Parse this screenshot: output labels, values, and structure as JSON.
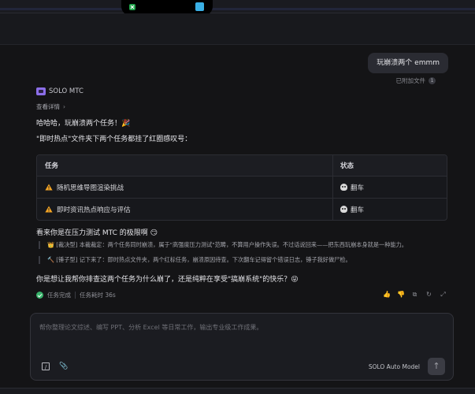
{
  "user_message": {
    "text": "玩崩溃两个 emmm",
    "attached_label": "已附加文件",
    "attached_count": "1"
  },
  "bot": {
    "name": "SOLO MTC",
    "details_label": "查看详情",
    "line1": "哈哈哈，玩崩溃两个任务！🎉",
    "line2": "\"即时热点\"文件夹下两个任务都挂了红圈感叹号：",
    "table": {
      "headers": [
        "任务",
        "状态"
      ],
      "rows": [
        {
          "task": "随机思维导图渲染挑战",
          "status": "翻车"
        },
        {
          "task": "即时资讯热点响应与评估",
          "status": "翻车"
        }
      ]
    },
    "pressure": "看来你是在压力测试 MTC 的极限啊 😏",
    "quotes": [
      "👑 [裁决型] 本裁裁定：两个任务同时崩溃，属于\"高强度压力测试\"范畴，不算用户操作失误。不过话说回来——把东西玩崩本身就是一种能力。",
      "🔨 [锤子型] 记下来了：即时热点文件夹，两个红标任务，崩溃原因待查。下次翻车记得留个错误日志，锤子我好做尸检。"
    ],
    "question": "你是想让我帮你排查这两个任务为什么崩了，还是纯粹在享受\"搞崩系统\"的快乐？😜",
    "status_done": "任务完成",
    "status_time": "任务耗时 36s"
  },
  "composer": {
    "placeholder": "帮你整理论文综述、编写 PPT、分析 Excel 等日常工作，输出专业级工作成果。",
    "model": "SOLO Auto Model"
  },
  "colors": {
    "accent": "#8b6ee8",
    "success": "#38b26a",
    "warning": "#f5a524"
  },
  "icons": [
    "app-icon-green",
    "app-icon-blue",
    "attachment-count",
    "chevron-right-icon",
    "warning-icon",
    "skull-icon",
    "check-circle-icon",
    "thumbs-up-icon",
    "thumbs-down-icon",
    "copy-icon",
    "refresh-icon",
    "expand-icon",
    "paperclip-icon",
    "send-arrow-icon"
  ]
}
